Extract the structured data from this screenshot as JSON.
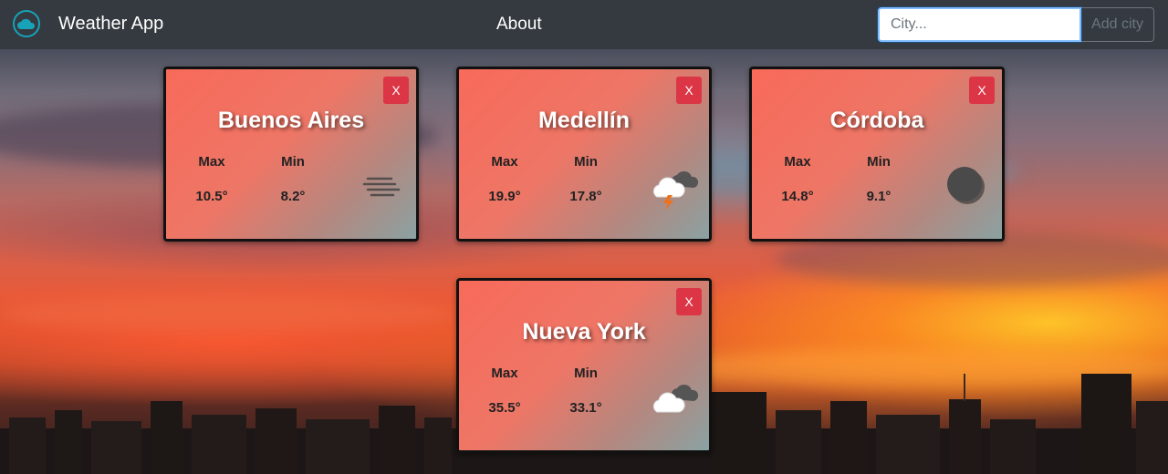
{
  "navbar": {
    "brand": "Weather App",
    "about": "About",
    "search_placeholder": "City...",
    "add_button": "Add city"
  },
  "cards": [
    {
      "city": "Buenos Aires",
      "max_label": "Max",
      "min_label": "Min",
      "max": "10.5°",
      "min": "8.2°",
      "close": "X",
      "icon": "mist-icon"
    },
    {
      "city": "Medellín",
      "max_label": "Max",
      "min_label": "Min",
      "max": "19.9°",
      "min": "17.8°",
      "close": "X",
      "icon": "thunderstorm-icon"
    },
    {
      "city": "Córdoba",
      "max_label": "Max",
      "min_label": "Min",
      "max": "14.8°",
      "min": "9.1°",
      "close": "X",
      "icon": "overcast-icon"
    },
    {
      "city": "Nueva York",
      "max_label": "Max",
      "min_label": "Min",
      "max": "35.5°",
      "min": "33.1°",
      "close": "X",
      "icon": "cloudy-icon"
    }
  ],
  "colors": {
    "navbar": "#343a40",
    "close_button": "#dc3545",
    "card_gradient_start": "#f86a5a",
    "card_gradient_end": "#8aa2a2",
    "logo_accent": "#17a2b8"
  }
}
